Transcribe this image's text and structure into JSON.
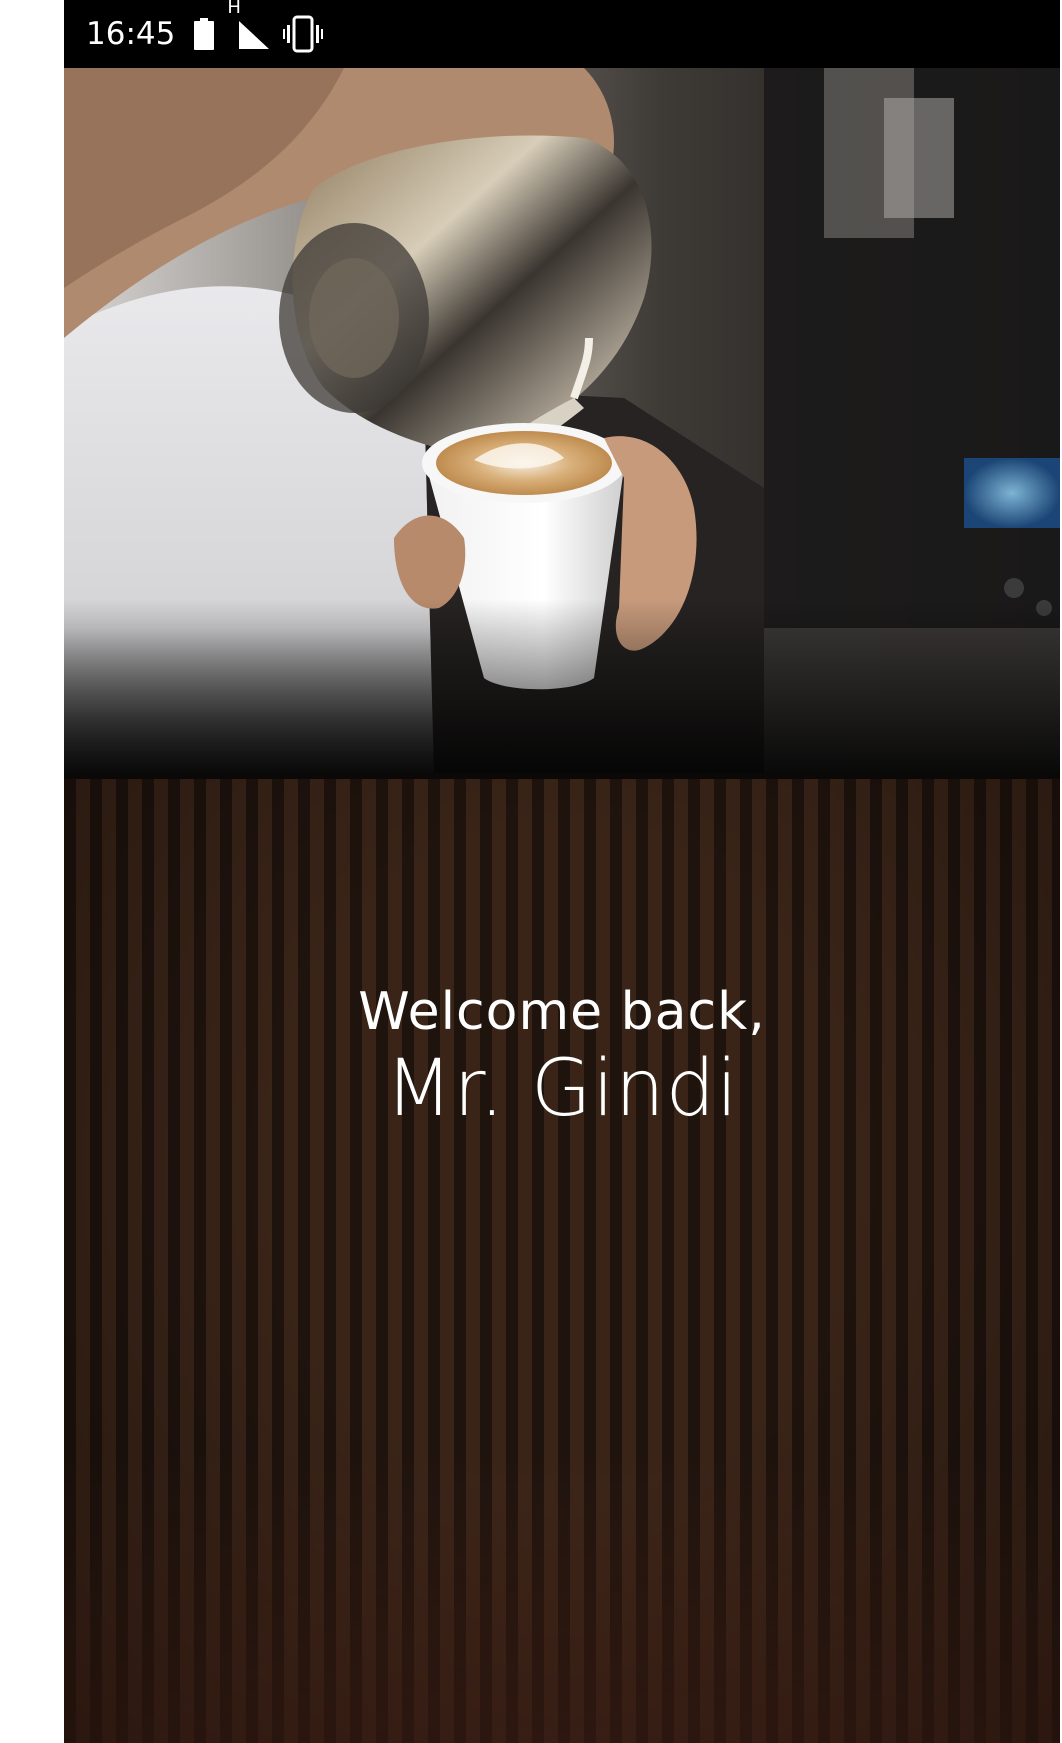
{
  "status_bar": {
    "time": "16:45",
    "network_type": "H",
    "icons": [
      "battery-icon",
      "signal-icon",
      "vibrate-icon"
    ]
  },
  "hero": {
    "image_description_icon": "latte-art-photo"
  },
  "welcome": {
    "greeting": "Welcome back,",
    "name": "Mr. Gindi"
  },
  "colors": {
    "status_bar_bg": "#000000",
    "panel_dark": "#1f130d",
    "panel_stripe": "#3a2418",
    "text": "#ffffff"
  }
}
